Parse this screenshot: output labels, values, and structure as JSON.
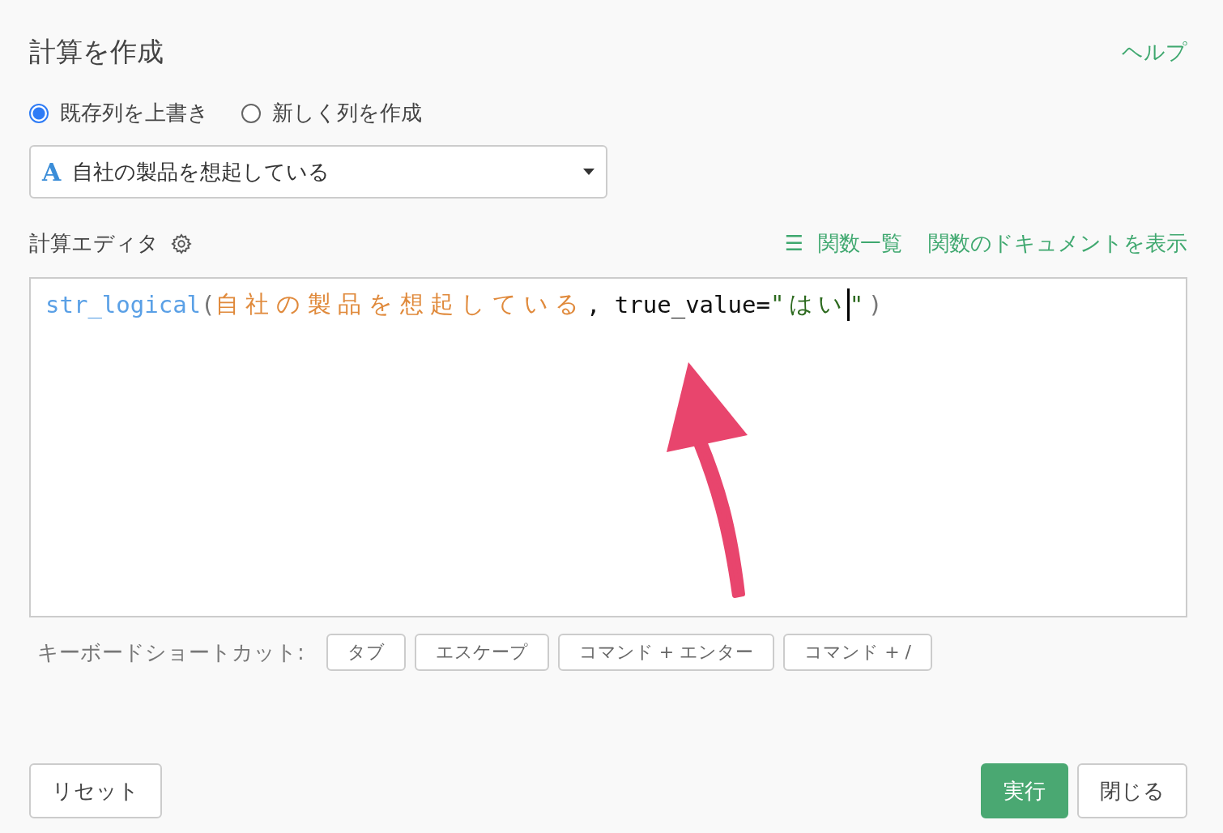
{
  "dialog": {
    "title": "計算を作成",
    "help_link": "ヘルプ"
  },
  "mode_options": [
    {
      "label": "既存列を上書き",
      "selected": true
    },
    {
      "label": "新しく列を作成",
      "selected": false
    }
  ],
  "column_select": {
    "type_icon": "A",
    "value": "自社の製品を想起している"
  },
  "editor": {
    "label": "計算エディタ",
    "function_list_icon": "☰",
    "function_list_link": "関数一覧",
    "docs_link": "関数のドキュメントを表示",
    "code": [
      {
        "kind": "function",
        "text": "str_logical"
      },
      {
        "kind": "paren",
        "text": "("
      },
      {
        "kind": "column",
        "text": "自社の製品を想起している"
      },
      {
        "kind": "plain",
        "text": ", true_value="
      },
      {
        "kind": "string",
        "text": "\"はい"
      },
      {
        "kind": "cursor"
      },
      {
        "kind": "string",
        "text": "\""
      },
      {
        "kind": "paren",
        "text": ")"
      }
    ]
  },
  "shortcuts": {
    "label": "キーボードショートカット:",
    "keys": [
      "タブ",
      "エスケープ",
      "コマンド + エンター",
      "コマンド + /"
    ]
  },
  "buttons": {
    "reset": "リセット",
    "run": "実行",
    "close": "閉じる"
  }
}
